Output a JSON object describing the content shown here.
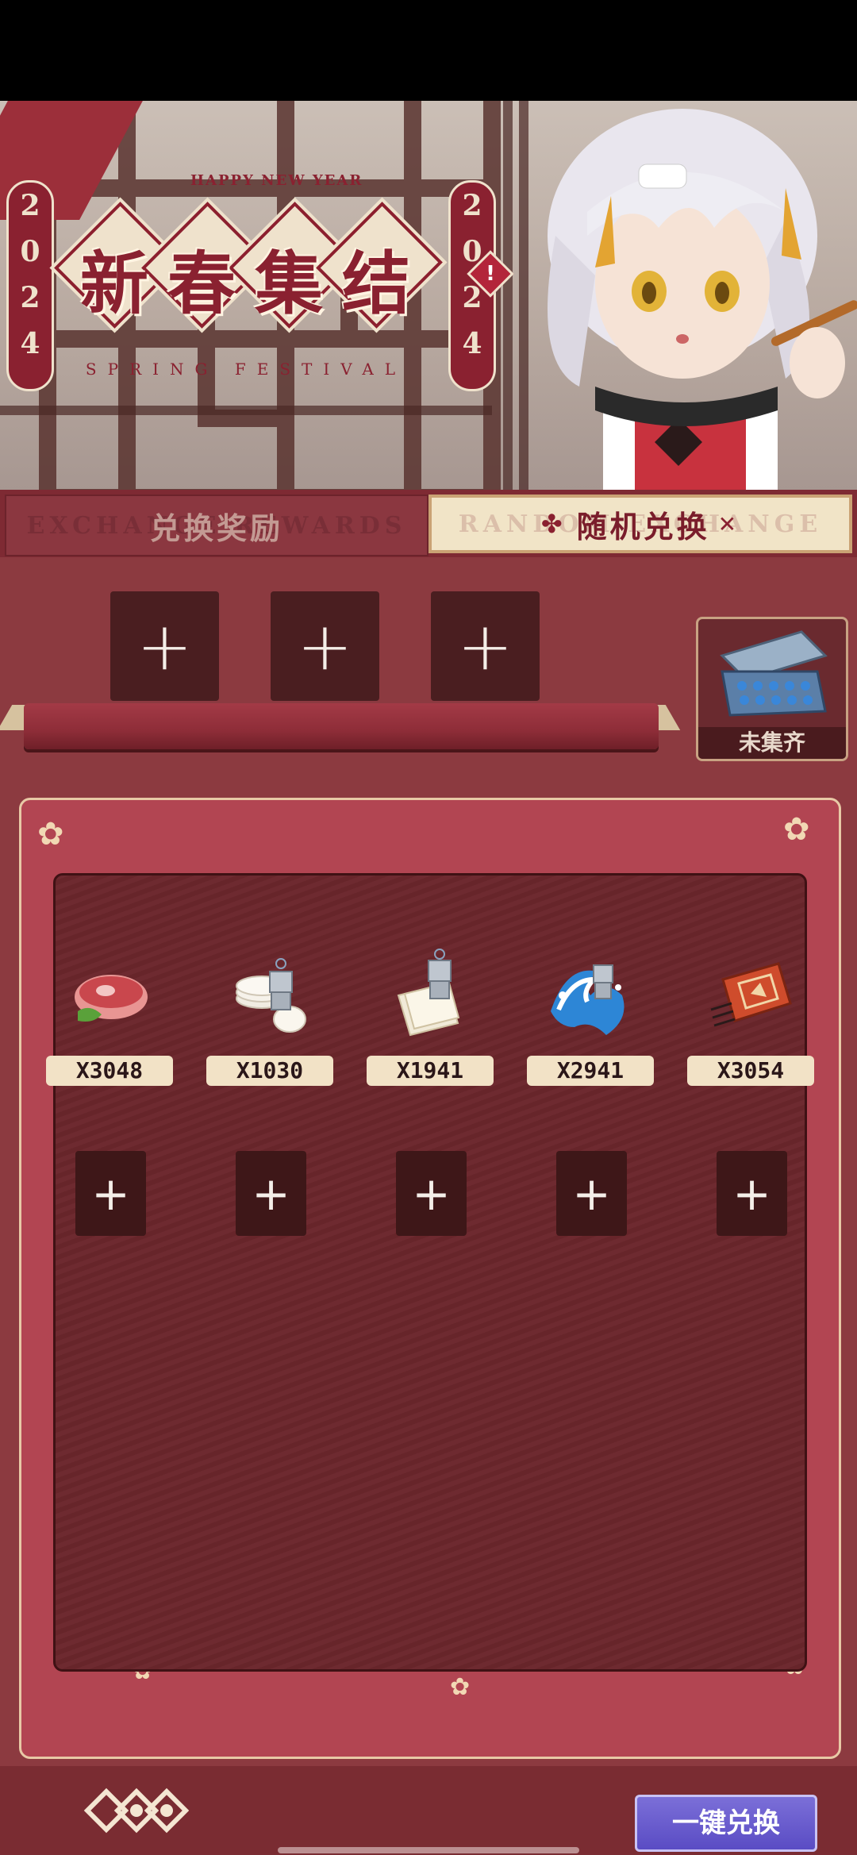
{
  "banner": {
    "happy_new_year": "HAPPY NEW YEAR",
    "title_chars": [
      "新",
      "春",
      "集",
      "结"
    ],
    "subtitle": "SPRING FESTIVAL",
    "year_digits": [
      "2",
      "0",
      "2",
      "4"
    ],
    "alert_mark": "!"
  },
  "tabs": [
    {
      "label": "兑换奖励",
      "watermark": "EXCHANGE REWARDS",
      "active": false
    },
    {
      "label": "随机兑换",
      "watermark": "RANDOM EXCHANGE",
      "active": true
    }
  ],
  "collection": {
    "label": "未集齐"
  },
  "items": [
    {
      "name": "meat",
      "count": "X3048"
    },
    {
      "name": "plates",
      "count": "X1030"
    },
    {
      "name": "paper",
      "count": "X1941"
    },
    {
      "name": "wave",
      "count": "X2941"
    },
    {
      "name": "matchbox",
      "count": "X3054"
    }
  ],
  "footer": {
    "exchange_all_label": "一键兑换"
  },
  "colors": {
    "accent": "#8a2130",
    "panel": "#b24552",
    "button": "#5a4cc4"
  }
}
